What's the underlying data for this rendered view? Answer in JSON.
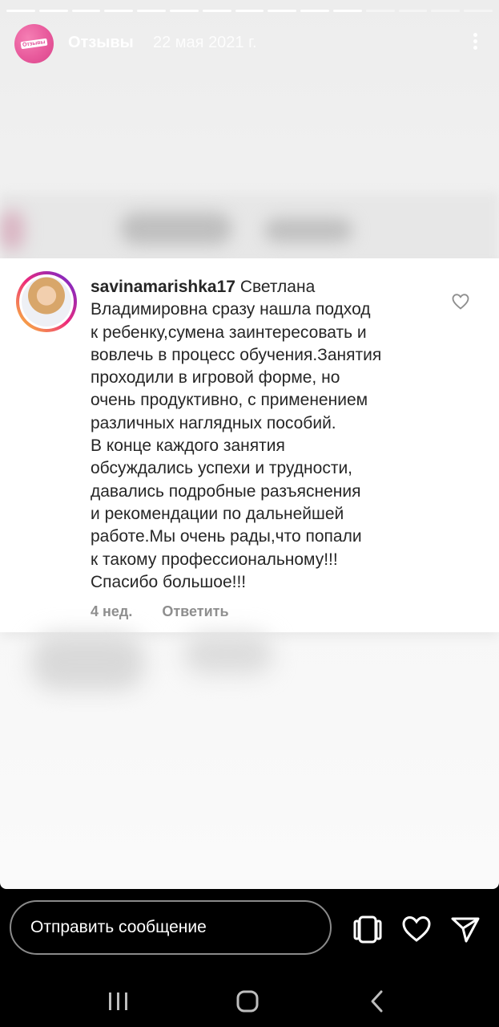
{
  "story": {
    "progress": {
      "completed": 11,
      "total": 15
    },
    "header": {
      "title": "Отзывы",
      "date": "22 мая 2021 г."
    },
    "brand_avatar_text": "Отзывы"
  },
  "comment": {
    "username": "savinamarishka17",
    "lines": [
      "Светлана",
      "Владимировна сразу нашла подход",
      "к ребенку,сумена заинтересовать и",
      "вовлечь в процесс обучения.Занятия",
      "проходили в игровой форме, но",
      "очень продуктивно, с применением",
      "различных наглядных пособий.",
      "В конце каждого занятия",
      "обсуждались успехи и трудности,",
      "давались подробные разъяснения",
      "и рекомендации по дальнейшей",
      "работе.Мы очень рады,что попали",
      "к такому профессиональному!!!",
      "Спасибо большое!!!"
    ],
    "age": "4 нед.",
    "reply_label": "Ответить"
  },
  "bottom_bar": {
    "message_placeholder": "Отправить сообщение",
    "icons": [
      "sticker-icon",
      "heart-icon",
      "send-icon"
    ]
  },
  "nav_bar": {
    "icons": [
      "recent-apps-icon",
      "home-icon",
      "back-icon"
    ]
  },
  "colors": {
    "brand_pink": "#e85a9c",
    "text": "#262626",
    "muted": "#8e8e8e"
  }
}
